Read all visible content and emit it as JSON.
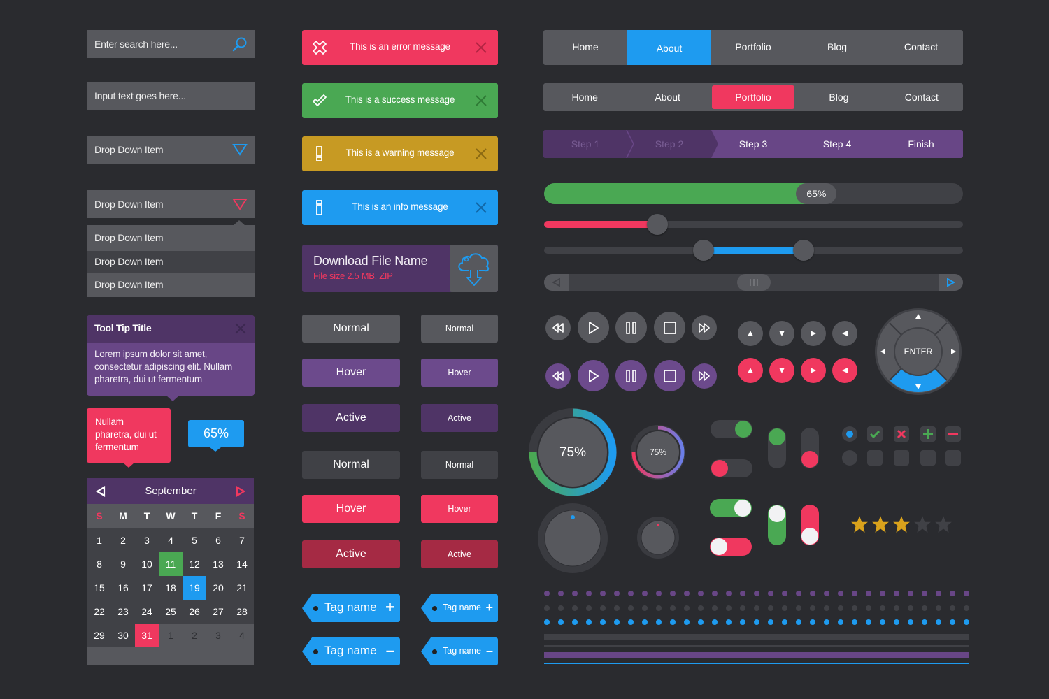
{
  "colors": {
    "background": "#2a2b2f",
    "panel": "#57585d",
    "panel_dark": "#404146",
    "purple": "#684686",
    "purple_dark": "#4f3466",
    "red": "#f0385f",
    "green": "#4aa853",
    "blue": "#1e9bf0",
    "yellow": "#c79a23",
    "star": "#d9a21c"
  },
  "inputs": {
    "search_placeholder": "Enter search here...",
    "text_placeholder": "Input text goes here...",
    "dropdown_closed_value": "Drop Down Item",
    "dropdown_open_value": "Drop Down Item",
    "dropdown_options": [
      "Drop Down Item",
      "Drop Down Item",
      "Drop Down Item"
    ]
  },
  "tooltip": {
    "title": "Tool Tip Title",
    "body": "Lorem ipsum dolor sit amet, consectetur adipiscing elit. Nullam pharetra, dui ut fermentum"
  },
  "tip_red": {
    "text": "Nullam pharetra, dui ut fermentum"
  },
  "tip_blue": {
    "text": "65%"
  },
  "calendar": {
    "month": "September",
    "weekdays": [
      "S",
      "M",
      "T",
      "W",
      "T",
      "F",
      "S"
    ],
    "days": [
      {
        "d": "1"
      },
      {
        "d": "2"
      },
      {
        "d": "3"
      },
      {
        "d": "4"
      },
      {
        "d": "5"
      },
      {
        "d": "6"
      },
      {
        "d": "7"
      },
      {
        "d": "8"
      },
      {
        "d": "9"
      },
      {
        "d": "10"
      },
      {
        "d": "11",
        "state": "green"
      },
      {
        "d": "12"
      },
      {
        "d": "13"
      },
      {
        "d": "14"
      },
      {
        "d": "15"
      },
      {
        "d": "16"
      },
      {
        "d": "17"
      },
      {
        "d": "18"
      },
      {
        "d": "19",
        "state": "blue"
      },
      {
        "d": "20"
      },
      {
        "d": "21"
      },
      {
        "d": "22"
      },
      {
        "d": "23"
      },
      {
        "d": "24"
      },
      {
        "d": "25"
      },
      {
        "d": "26"
      },
      {
        "d": "27"
      },
      {
        "d": "28"
      },
      {
        "d": "29"
      },
      {
        "d": "30"
      },
      {
        "d": "31",
        "state": "red"
      },
      {
        "d": "1",
        "state": "other"
      },
      {
        "d": "2",
        "state": "other"
      },
      {
        "d": "3",
        "state": "other"
      },
      {
        "d": "4",
        "state": "other"
      }
    ]
  },
  "alerts": {
    "error": "This is an error message",
    "success": "This is a success message",
    "warning": "This is a warning message",
    "info": "This is an info message"
  },
  "download": {
    "name": "Download File Name",
    "size": "File size  2.5 MB, ZIP"
  },
  "buttons": {
    "normal": "Normal",
    "hover": "Hover",
    "active": "Active"
  },
  "tags": {
    "label": "Tag name",
    "add": "+",
    "remove": "–"
  },
  "nav1": {
    "items": [
      "Home",
      "About",
      "Portfolio",
      "Blog",
      "Contact"
    ],
    "selected": 1
  },
  "nav2": {
    "items": [
      "Home",
      "About",
      "Portfolio",
      "Blog",
      "Contact"
    ],
    "selected": 2
  },
  "steps": {
    "items": [
      "Step 1",
      "Step 2",
      "Step 3",
      "Step 4",
      "Finish"
    ],
    "completed": 2
  },
  "progress": {
    "value": 65,
    "label": "65%"
  },
  "slider_single": {
    "value": 0.27
  },
  "slider_range": {
    "low": 0.38,
    "high": 0.62
  },
  "scrollbar": {
    "position": 0.5
  },
  "gauges": {
    "large": {
      "value": 75,
      "label": "75%"
    },
    "small": {
      "value": 75,
      "label": "75%"
    }
  },
  "dial": {
    "center_label": "ENTER"
  },
  "toggles": {
    "row1": [
      true,
      false
    ],
    "vertical1": [
      true,
      false
    ],
    "row2": [
      true,
      false
    ],
    "vertical2": [
      true,
      false
    ]
  },
  "checkboxes": {
    "checked_row": [
      "radio-selected",
      "check",
      "cross",
      "plus",
      "minus"
    ],
    "empty_row": [
      "radio",
      "box",
      "box",
      "box",
      "box"
    ]
  },
  "rating": {
    "value": 3,
    "max": 5
  },
  "dot_rows": 3,
  "dots_per_row": 31
}
